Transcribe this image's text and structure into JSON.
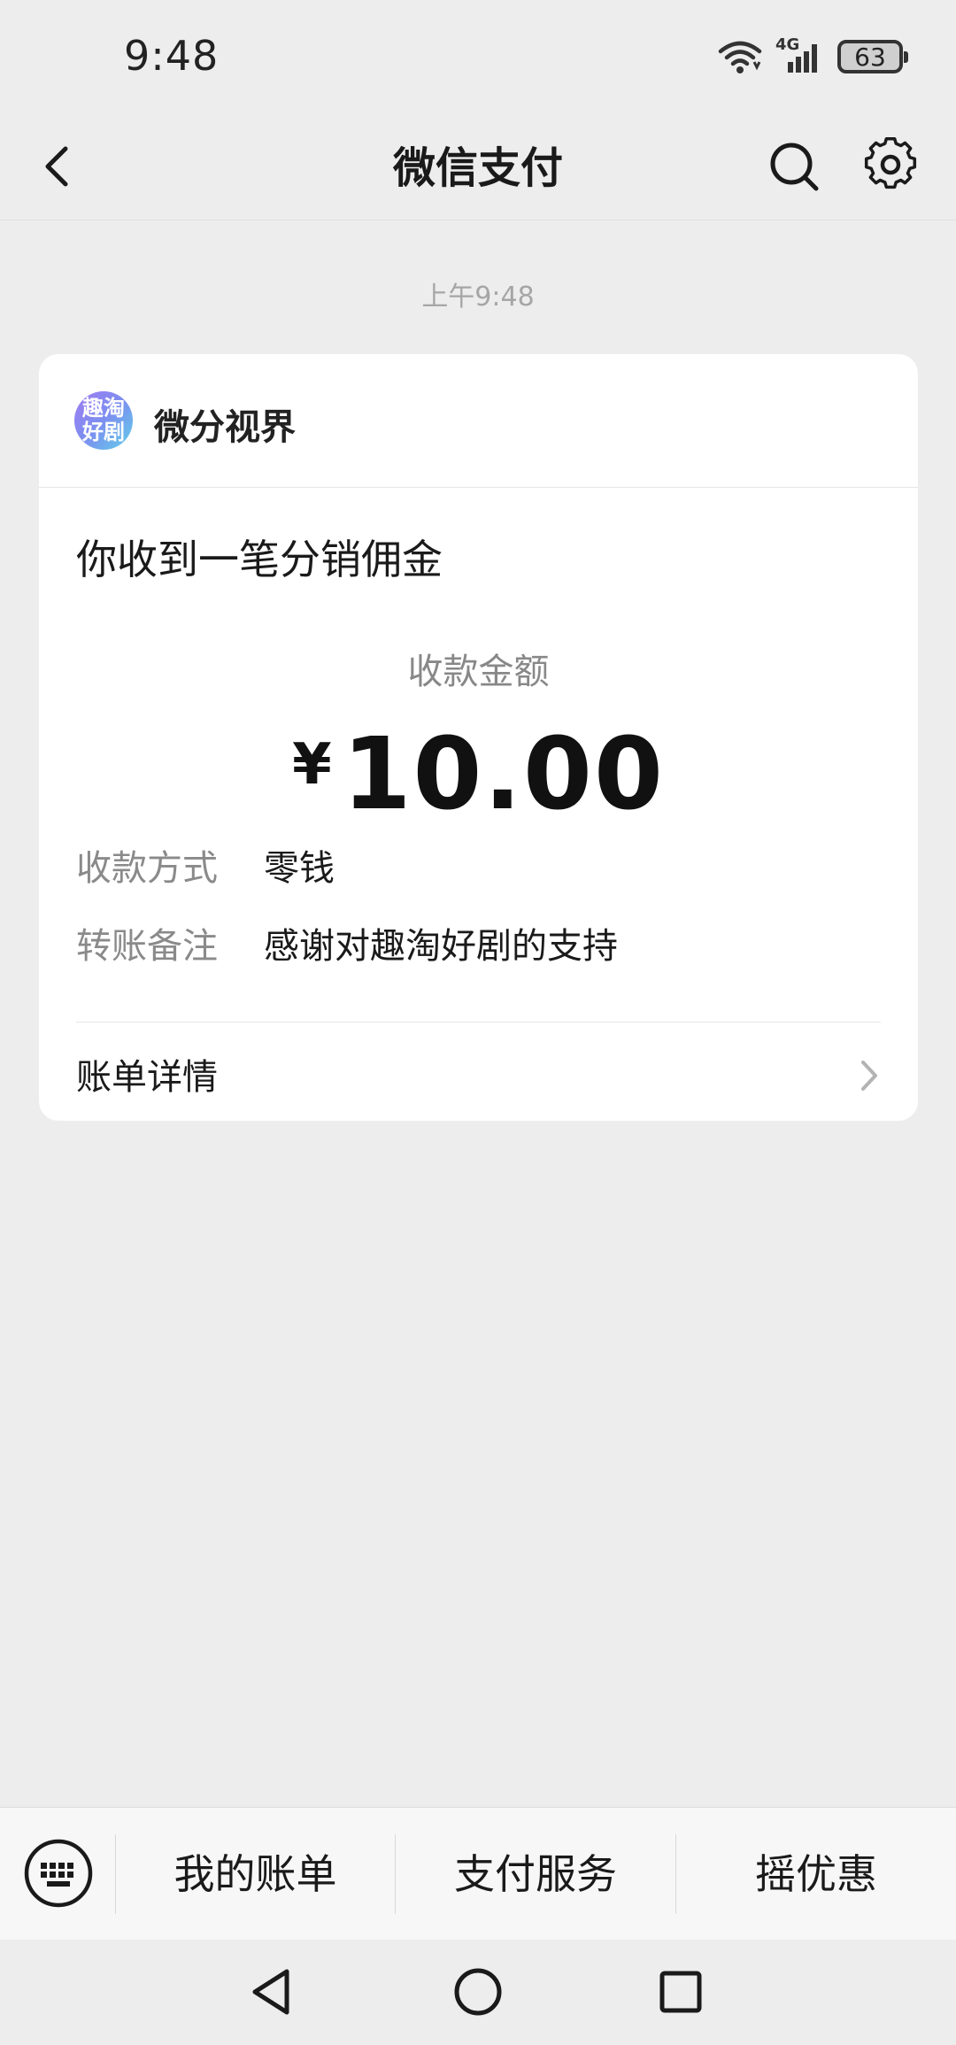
{
  "status_bar": {
    "time": "9:48",
    "network": "4G",
    "battery": "63"
  },
  "nav": {
    "title": "微信支付"
  },
  "message": {
    "time": "上午9:48",
    "merchant": {
      "name": "微分视界",
      "avatar_text_line1": "趣淘",
      "avatar_text_line2": "好剧"
    },
    "title": "你收到一笔分销佣金",
    "amount_label": "收款金额",
    "currency": "¥",
    "amount": "10.00",
    "details": [
      {
        "key": "收款方式",
        "value": "零钱"
      },
      {
        "key": "转账备注",
        "value": "感谢对趣淘好剧的支持"
      }
    ],
    "bill_detail": "账单详情"
  },
  "bottom_menu": {
    "items": [
      "我的账单",
      "支付服务",
      "摇优惠"
    ]
  },
  "colors": {
    "background": "#ededed",
    "card": "#ffffff",
    "muted_text": "#8a8a8a"
  }
}
